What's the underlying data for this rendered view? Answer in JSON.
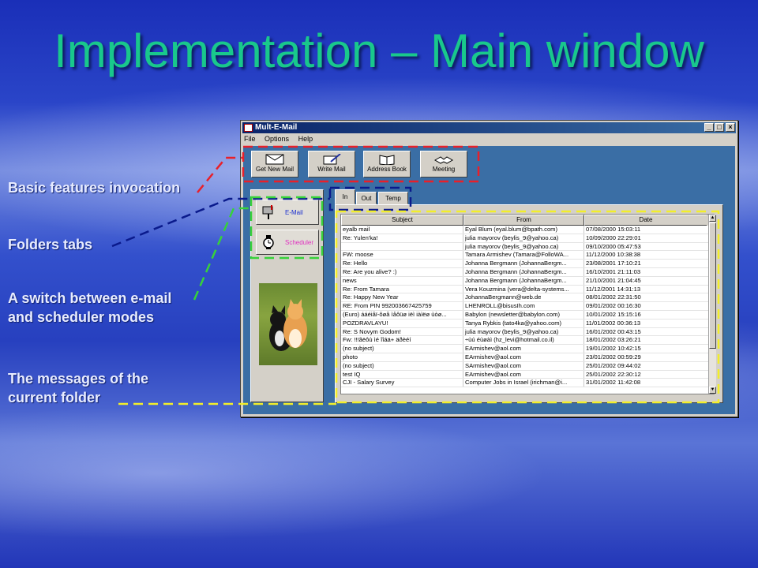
{
  "slide": {
    "title": "Implementation – Main window"
  },
  "callouts": {
    "basic_features": "Basic features invocation",
    "folders_tabs": "Folders tabs",
    "switch_line1": "A switch between e-mail",
    "switch_line2": "and scheduler modes",
    "messages_line1": "The messages of the",
    "messages_line2": "current folder"
  },
  "annotation_colors": {
    "red": "#e8202a",
    "navy": "#0a1a8c",
    "green": "#37d23a",
    "yellow": "#f2ee2a"
  },
  "window": {
    "title": "Mult-E-Mail",
    "controls": {
      "minimize": "_",
      "maximize": "□",
      "close": "×"
    },
    "menu": [
      "File",
      "Options",
      "Help"
    ]
  },
  "toolbar": {
    "buttons": [
      {
        "label": "Get New Mail",
        "icon": "mailbox-icon"
      },
      {
        "label": "Write Mail",
        "icon": "pen-letter-icon"
      },
      {
        "label": "Address Book",
        "icon": "book-icon"
      },
      {
        "label": "Meeting",
        "icon": "handshake-icon"
      }
    ]
  },
  "modes": {
    "email": {
      "label": "E-Mail",
      "icon": "mailbox-icon",
      "color": "#1a2fd0"
    },
    "scheduler": {
      "label": "Scheduler",
      "icon": "clock-icon",
      "color": "#e030c0"
    }
  },
  "folder_tabs": [
    "In",
    "Out",
    "Temp"
  ],
  "messages": {
    "columns": [
      "Subject",
      "From",
      "Date"
    ],
    "rows": [
      [
        "eyalb mail",
        "Eyal Blum (eyal.blum@bpath.com)",
        "07/08/2000 15:03:11"
      ],
      [
        "Re: Yulen'ka!",
        "julia mayorov (beylis_9@yahoo.ca)",
        "10/09/2000 22:29:01"
      ],
      [
        "",
        "julia mayorov (beylis_9@yahoo.ca)",
        "09/10/2000 05:47:53"
      ],
      [
        "FW: moose",
        "Tamara Armishev (Tamara@FolloWA...",
        "11/12/2000 10:38:38"
      ],
      [
        "Re: Hello",
        "Johanna Bergmann (JohannaBergm...",
        "23/08/2001 17:10:21"
      ],
      [
        "Re: Are you alive? :)",
        "Johanna Bergmann (JohannaBergm...",
        "16/10/2001 21:11:03"
      ],
      [
        "news",
        "Johanna Bergmann (JohannaBergm...",
        "21/10/2001 21:04:45"
      ],
      [
        "Re: From Tamara",
        "Vera Kouzmina (vera@delta-systems...",
        "11/12/2001 14:31:13"
      ],
      [
        "Re: Happy New Year",
        "JohannaBergmann@web.de",
        "08/01/2002 22:31:50"
      ],
      [
        "RE: From PIN 992003667425759",
        "LHENROLL@bisusIh.com",
        "09/01/2002 00:16:30"
      ],
      [
        "(Euro) ááéiåï-ôøå ìåôüø iëì iàìëø ùòø...",
        "Babylon (newsletter@babylon.com)",
        "10/01/2002 15:15:16"
      ],
      [
        "POZDRAVLAYU!",
        "Tanya Rybkis (tato4ka@yahoo.com)",
        "11/01/2002 00:36:13"
      ],
      [
        "Re: S Novym Godom!",
        "julia mayorov (beylis_9@yahoo.ca)",
        "16/01/2002 00:43:15"
      ],
      [
        "Fw: !!!ãëôù ìé îîáä+ äðèéí",
        "÷ùú éùøàì (hz_levi@hotmail.co.il)",
        "18/01/2002 03:26:21"
      ],
      [
        "(no subject)",
        "EArmishev@aol.com",
        "19/01/2002 10:42:15"
      ],
      [
        "photo",
        "EArmishev@aol.com",
        "23/01/2002 00:59:29"
      ],
      [
        "(no subject)",
        "SArmishev@aol.com",
        "25/01/2002 09:44:02"
      ],
      [
        "test IQ",
        "EArmishev@aol.com",
        "25/01/2002 22:30:12"
      ],
      [
        "CJI - Salary Survey",
        "Computer Jobs in Israel (irichman@i...",
        "31/01/2002 11:42:08"
      ]
    ]
  }
}
